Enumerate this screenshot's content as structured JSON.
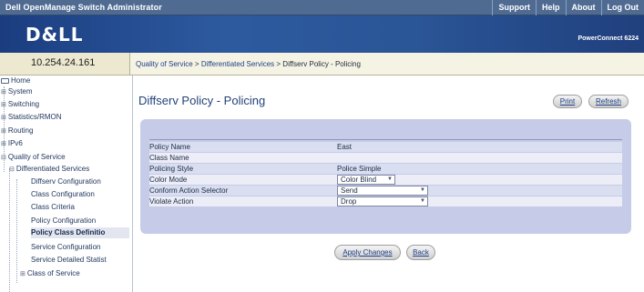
{
  "header": {
    "app_title": "Dell OpenManage Switch Administrator",
    "links": [
      "Support",
      "Help",
      "About",
      "Log Out"
    ],
    "logo": "D&LL",
    "product": "PowerConnect 6224"
  },
  "address": "10.254.24.161",
  "breadcrumb": {
    "part1": "Quality of Service",
    "sep1": " > ",
    "part2": "Differentiated Services",
    "sep2": " > ",
    "current": "Diffserv Policy - Policing"
  },
  "sidebar": {
    "home": "Home",
    "system": "System",
    "switching": "Switching",
    "statistics": "Statistics/RMON",
    "routing": "Routing",
    "ipv6": "IPv6",
    "qos": "Quality of Service",
    "diffserv": "Differentiated Services",
    "diffserv_config": "Diffserv Configuration",
    "class_config": "Class Configuration",
    "class_criteria": "Class Criteria",
    "policy_config": "Policy Configuration",
    "policy_class_def": "Policy Class Definitio",
    "service_config": "Service Configuration",
    "service_stats": "Service Detailed Statist",
    "class_of_service": "Class of Service"
  },
  "main": {
    "title": "Diffserv Policy - Policing",
    "print": "Print",
    "refresh": "Refresh",
    "fields": {
      "policy_name_label": "Policy Name",
      "policy_name_value": "East",
      "class_name_label": "Class Name",
      "class_name_value": "",
      "policing_style_label": "Policing Style",
      "policing_style_value": "Police Simple",
      "color_mode_label": "Color Mode",
      "color_mode_value": "Color Blind",
      "conform_action_label": "Conform Action Selector",
      "conform_action_value": "Send",
      "violate_action_label": "Violate Action",
      "violate_action_value": "Drop"
    },
    "apply": "Apply Changes",
    "back": "Back"
  }
}
